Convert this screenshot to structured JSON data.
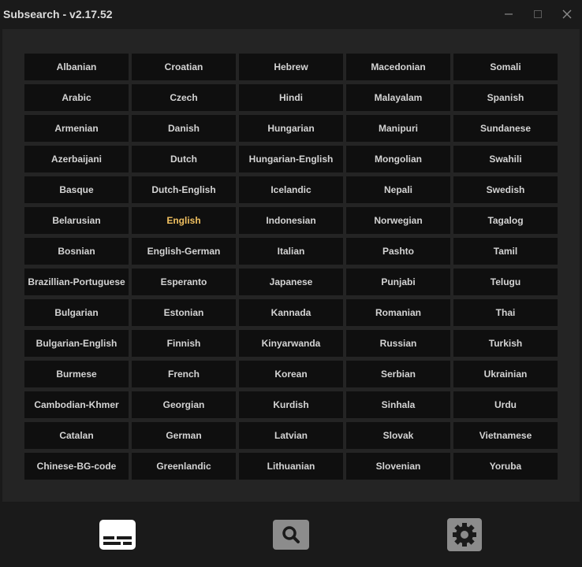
{
  "window": {
    "title": "Subsearch - v2.17.52",
    "controls": [
      "minimize-icon",
      "maximize-icon",
      "close-icon"
    ]
  },
  "languages": {
    "selected": "English",
    "selected_color": "#f0c060",
    "items": [
      "Albanian",
      "Croatian",
      "Hebrew",
      "Macedonian",
      "Somali",
      "Arabic",
      "Czech",
      "Hindi",
      "Malayalam",
      "Spanish",
      "Armenian",
      "Danish",
      "Hungarian",
      "Manipuri",
      "Sundanese",
      "Azerbaijani",
      "Dutch",
      "Hungarian-English",
      "Mongolian",
      "Swahili",
      "Basque",
      "Dutch-English",
      "Icelandic",
      "Nepali",
      "Swedish",
      "Belarusian",
      "English",
      "Indonesian",
      "Norwegian",
      "Tagalog",
      "Bosnian",
      "English-German",
      "Italian",
      "Pashto",
      "Tamil",
      "Brazillian-Portuguese",
      "Esperanto",
      "Japanese",
      "Punjabi",
      "Telugu",
      "Bulgarian",
      "Estonian",
      "Kannada",
      "Romanian",
      "Thai",
      "Bulgarian-English",
      "Finnish",
      "Kinyarwanda",
      "Russian",
      "Turkish",
      "Burmese",
      "French",
      "Korean",
      "Serbian",
      "Ukrainian",
      "Cambodian-Khmer",
      "Georgian",
      "Kurdish",
      "Sinhala",
      "Urdu",
      "Catalan",
      "German",
      "Latvian",
      "Slovak",
      "Vietnamese",
      "Chinese-BG-code",
      "Greenlandic",
      "Lithuanian",
      "Slovenian",
      "Yoruba"
    ]
  },
  "footer": {
    "buttons": [
      "subtitles-icon",
      "search-icon",
      "gear-icon"
    ],
    "active_color": "#ffffff",
    "inactive_color": "#8c8c8c"
  }
}
